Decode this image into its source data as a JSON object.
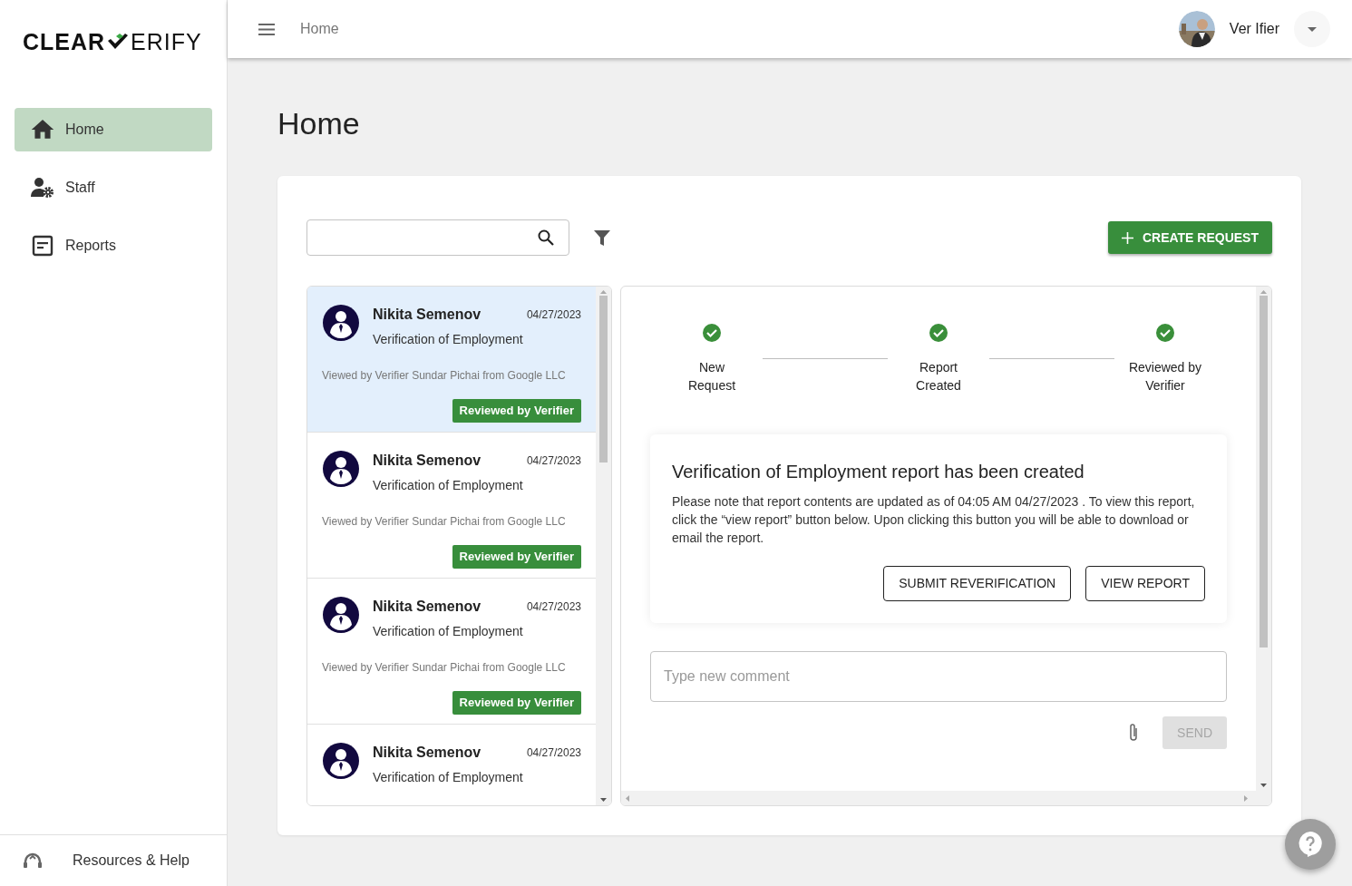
{
  "logo": {
    "left": "CLEAR",
    "right": "ERIFY"
  },
  "sidebar": {
    "items": [
      {
        "label": "Home",
        "selected": true
      },
      {
        "label": "Staff",
        "selected": false
      },
      {
        "label": "Reports",
        "selected": false
      }
    ],
    "footer": {
      "label": "Resources & Help"
    }
  },
  "header": {
    "breadcrumb": "Home",
    "user": {
      "name": "Ver Ifier"
    }
  },
  "page_title": "Home",
  "toolbar": {
    "create_button": "CREATE REQUEST"
  },
  "requests": [
    {
      "name": "Nikita Semenov",
      "date": "04/27/2023",
      "type": "Verification of Employment",
      "note": "Viewed by Verifier Sundar Pichai from Google LLC",
      "status": "Reviewed by Verifier",
      "selected": true
    },
    {
      "name": "Nikita Semenov",
      "date": "04/27/2023",
      "type": "Verification of Employment",
      "note": "Viewed by Verifier Sundar Pichai from Google LLC",
      "status": "Reviewed by Verifier",
      "selected": false
    },
    {
      "name": "Nikita Semenov",
      "date": "04/27/2023",
      "type": "Verification of Employment",
      "note": "Viewed by Verifier Sundar Pichai from Google LLC",
      "status": "Reviewed by Verifier",
      "selected": false
    },
    {
      "name": "Nikita Semenov",
      "date": "04/27/2023",
      "type": "Verification of Employment",
      "selected": false
    }
  ],
  "detail": {
    "steps": [
      {
        "label": "New Request",
        "done": true
      },
      {
        "label": "Report Created",
        "done": true
      },
      {
        "label": "Reviewed by Verifier",
        "done": true
      }
    ],
    "report": {
      "title": "Verification of Employment report has been created",
      "body": "Please note that report contents are updated as of 04:05 AM 04/27/2023 . To view this report, click the “view report” button below. Upon clicking this button you will be able to download or email the report.",
      "buttons": [
        "SUBMIT REVERIFICATION",
        "VIEW REPORT"
      ]
    },
    "comment": {
      "placeholder": "Type new comment",
      "send": "SEND",
      "send_disabled": true
    }
  }
}
